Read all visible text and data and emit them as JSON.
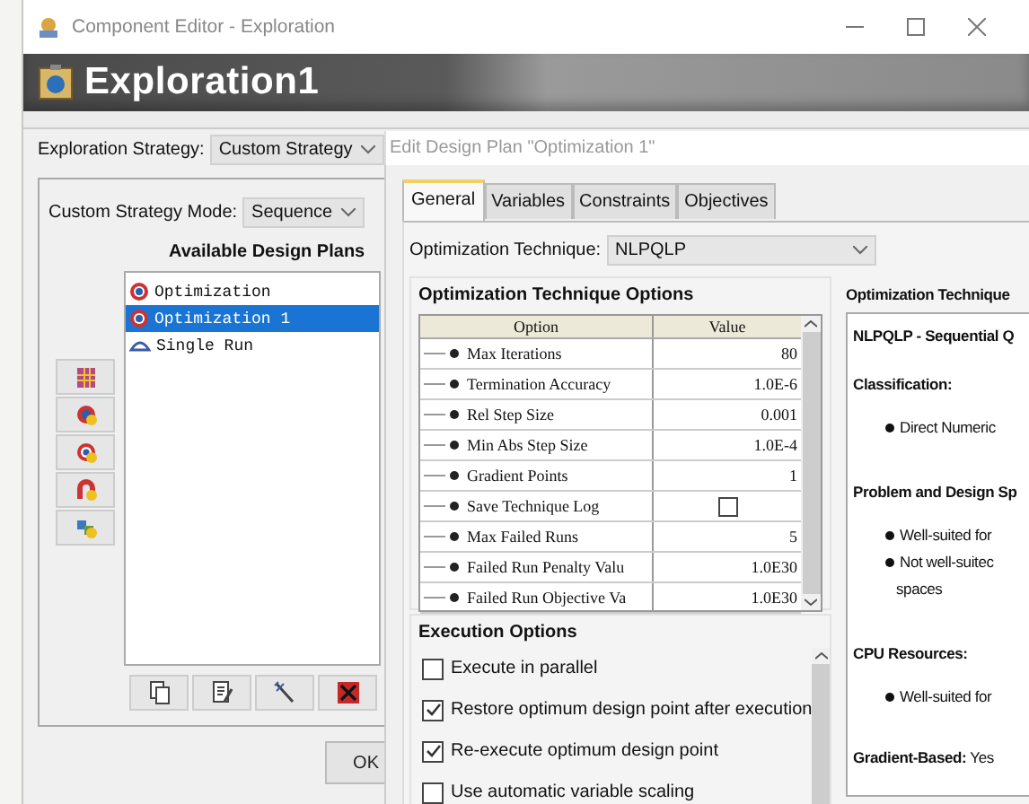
{
  "window": {
    "title": "Component Editor - Exploration"
  },
  "banner": {
    "title": "Exploration1"
  },
  "strategy": {
    "label": "Exploration Strategy:",
    "value": "Custom Strategy"
  },
  "mode": {
    "label": "Custom Strategy Mode:",
    "value": "Sequence"
  },
  "plans": {
    "heading": "Available Design Plans",
    "items": [
      {
        "label": "Optimization",
        "kind": "optimization",
        "selected": false
      },
      {
        "label": "Optimization 1",
        "kind": "optimization",
        "selected": true
      },
      {
        "label": "Single Run",
        "kind": "single",
        "selected": false
      }
    ]
  },
  "ok_button": "OK",
  "editor": {
    "title": "Edit Design Plan \"Optimization 1\"",
    "tabs": [
      {
        "label": "General",
        "selected": true
      },
      {
        "label": "Variables",
        "selected": false
      },
      {
        "label": "Constraints",
        "selected": false
      },
      {
        "label": "Objectives",
        "selected": false
      }
    ],
    "technique": {
      "label": "Optimization Technique:",
      "value": "NLPQLP"
    },
    "options": {
      "heading": "Optimization Technique Options",
      "columns": [
        "Option",
        "Value"
      ],
      "rows": [
        {
          "name": "Max Iterations",
          "kind": "text",
          "value": "80"
        },
        {
          "name": "Termination Accuracy",
          "kind": "text",
          "value": "1.0E-6"
        },
        {
          "name": "Rel Step Size",
          "kind": "text",
          "value": "0.001"
        },
        {
          "name": "Min Abs Step Size",
          "kind": "text",
          "value": "1.0E-4"
        },
        {
          "name": "Gradient Points",
          "kind": "text",
          "value": "1"
        },
        {
          "name": "Save Technique Log",
          "kind": "checkbox",
          "checked": false
        },
        {
          "name": "Max Failed Runs",
          "kind": "text",
          "value": "5"
        },
        {
          "name": "Failed Run Penalty Valu",
          "kind": "text",
          "value": "1.0E30"
        },
        {
          "name": "Failed Run Objective Va",
          "kind": "text",
          "value": "1.0E30"
        }
      ]
    },
    "execution": {
      "heading": "Execution Options",
      "items": [
        {
          "label": "Execute in parallel",
          "checked": false
        },
        {
          "label": "Restore optimum design point after execution",
          "checked": true
        },
        {
          "label": "Re-execute optimum design point",
          "checked": true
        },
        {
          "label": "Use automatic variable scaling",
          "checked": false
        }
      ]
    },
    "info": {
      "heading": "Optimization Technique",
      "lines": [
        {
          "kind": "title",
          "text": "NLPQLP - Sequential Q"
        },
        {
          "kind": "section",
          "text": "Classification:"
        },
        {
          "kind": "bullet",
          "text": "Direct Numeric"
        },
        {
          "kind": "section",
          "text": "Problem and Design Sp"
        },
        {
          "kind": "bullet",
          "text": "Well-suited for"
        },
        {
          "kind": "bullet",
          "text": "Not well-suitec"
        },
        {
          "kind": "cont",
          "text": "spaces"
        },
        {
          "kind": "section",
          "text": "CPU Resources:"
        },
        {
          "kind": "bullet",
          "text": "Well-suited for"
        },
        {
          "kind": "text",
          "text": "**Gradient-Based:** Yes"
        }
      ]
    }
  }
}
